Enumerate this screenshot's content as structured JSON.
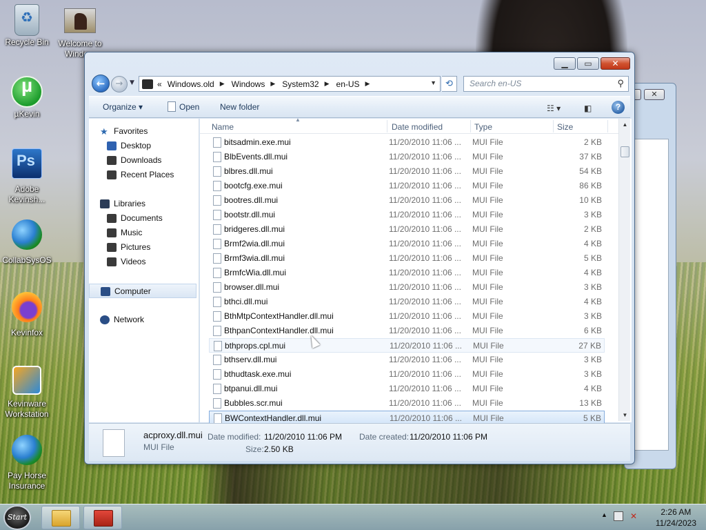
{
  "desktop": {
    "icons": [
      {
        "label": "Recycle Bin",
        "icon": "recycle-bin-icon"
      },
      {
        "label": "Welcome to Windo...",
        "icon": "horse-picture-icon"
      },
      {
        "label": "µKevin",
        "icon": "utorrent-icon"
      },
      {
        "label": "Adobe Kevinsh...",
        "icon": "photoshop-icon"
      },
      {
        "label": "CollabSysOS",
        "icon": "globe-icon"
      },
      {
        "label": "Kevinfox",
        "icon": "firefox-icon"
      },
      {
        "label": "Kevinware Workstation",
        "icon": "vmware-icon"
      },
      {
        "label": "Pay Horse Insurance",
        "icon": "globe-icon"
      }
    ]
  },
  "window": {
    "buttons": {
      "minimize": "▁",
      "maximize": "▭",
      "close": "✕"
    },
    "address": {
      "overflow": "«",
      "crumbs": [
        "Windows.old",
        "Windows",
        "System32",
        "en-US"
      ]
    },
    "search_placeholder": "Search en-US",
    "commands": {
      "organize": "Organize ▾",
      "open": "Open",
      "new_folder": "New folder"
    },
    "help": "?",
    "nav": {
      "favorites": "Favorites",
      "desktop": "Desktop",
      "downloads": "Downloads",
      "recent": "Recent Places",
      "libraries": "Libraries",
      "documents": "Documents",
      "music": "Music",
      "pictures": "Pictures",
      "videos": "Videos",
      "computer": "Computer",
      "network": "Network"
    },
    "columns": {
      "name": "Name",
      "date": "Date modified",
      "type": "Type",
      "size": "Size"
    },
    "files": [
      {
        "name": "bitsadmin.exe.mui",
        "date": "11/20/2010 11:06 ...",
        "type": "MUI File",
        "size": "2 KB"
      },
      {
        "name": "BlbEvents.dll.mui",
        "date": "11/20/2010 11:06 ...",
        "type": "MUI File",
        "size": "37 KB"
      },
      {
        "name": "blbres.dll.mui",
        "date": "11/20/2010 11:06 ...",
        "type": "MUI File",
        "size": "54 KB"
      },
      {
        "name": "bootcfg.exe.mui",
        "date": "11/20/2010 11:06 ...",
        "type": "MUI File",
        "size": "86 KB"
      },
      {
        "name": "bootres.dll.mui",
        "date": "11/20/2010 11:06 ...",
        "type": "MUI File",
        "size": "10 KB"
      },
      {
        "name": "bootstr.dll.mui",
        "date": "11/20/2010 11:06 ...",
        "type": "MUI File",
        "size": "3 KB"
      },
      {
        "name": "bridgeres.dll.mui",
        "date": "11/20/2010 11:06 ...",
        "type": "MUI File",
        "size": "2 KB"
      },
      {
        "name": "Brmf2wia.dll.mui",
        "date": "11/20/2010 11:06 ...",
        "type": "MUI File",
        "size": "4 KB"
      },
      {
        "name": "Brmf3wia.dll.mui",
        "date": "11/20/2010 11:06 ...",
        "type": "MUI File",
        "size": "5 KB"
      },
      {
        "name": "BrmfcWia.dll.mui",
        "date": "11/20/2010 11:06 ...",
        "type": "MUI File",
        "size": "4 KB"
      },
      {
        "name": "browser.dll.mui",
        "date": "11/20/2010 11:06 ...",
        "type": "MUI File",
        "size": "3 KB"
      },
      {
        "name": "bthci.dll.mui",
        "date": "11/20/2010 11:06 ...",
        "type": "MUI File",
        "size": "4 KB"
      },
      {
        "name": "BthMtpContextHandler.dll.mui",
        "date": "11/20/2010 11:06 ...",
        "type": "MUI File",
        "size": "3 KB"
      },
      {
        "name": "BthpanContextHandler.dll.mui",
        "date": "11/20/2010 11:06 ...",
        "type": "MUI File",
        "size": "6 KB"
      },
      {
        "name": "bthprops.cpl.mui",
        "date": "11/20/2010 11:06 ...",
        "type": "MUI File",
        "size": "27 KB"
      },
      {
        "name": "bthserv.dll.mui",
        "date": "11/20/2010 11:06 ...",
        "type": "MUI File",
        "size": "3 KB"
      },
      {
        "name": "bthudtask.exe.mui",
        "date": "11/20/2010 11:06 ...",
        "type": "MUI File",
        "size": "3 KB"
      },
      {
        "name": "btpanui.dll.mui",
        "date": "11/20/2010 11:06 ...",
        "type": "MUI File",
        "size": "4 KB"
      },
      {
        "name": "Bubbles.scr.mui",
        "date": "11/20/2010 11:06 ...",
        "type": "MUI File",
        "size": "13 KB"
      },
      {
        "name": "BWContextHandler.dll.mui",
        "date": "11/20/2010 11:06 ...",
        "type": "MUI File",
        "size": "5 KB"
      }
    ],
    "details": {
      "name": "acproxy.dll.mui",
      "type": "MUI File",
      "date_modified_label": "Date modified:",
      "date_modified": "11/20/2010 11:06 PM",
      "date_created_label": "Date created:",
      "date_created": "11/20/2010 11:06 PM",
      "size_label": "Size:",
      "size": "2.50 KB"
    }
  },
  "taskbar": {
    "start": "Start",
    "clock_time": "2:26 AM",
    "clock_date": "11/24/2023"
  }
}
